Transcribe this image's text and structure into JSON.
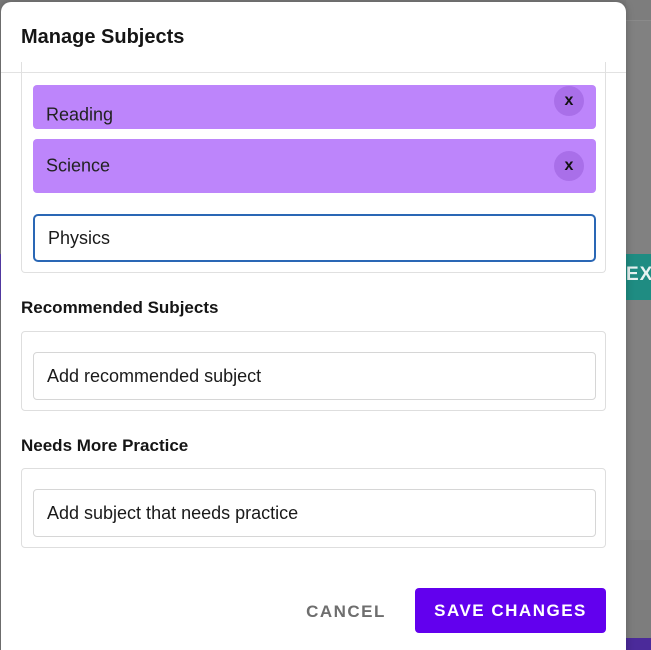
{
  "background": {
    "teal_button_fragment": "EX",
    "colors": {
      "teal": "#1f8c82",
      "purple": "#4b2a9a"
    }
  },
  "modal": {
    "title": "Manage Subjects",
    "subjects": {
      "chips": [
        {
          "label": "Reading",
          "remove_label": "x"
        },
        {
          "label": "Science",
          "remove_label": "x"
        }
      ],
      "input_value": "Physics",
      "chip_color": "#bd85fb"
    },
    "recommended": {
      "title": "Recommended Subjects",
      "placeholder": "Add recommended subject"
    },
    "practice": {
      "title": "Needs More Practice",
      "placeholder": "Add subject that needs practice"
    },
    "footer": {
      "cancel_label": "CANCEL",
      "save_label": "SAVE CHANGES",
      "accent_color": "#6200ee"
    }
  }
}
